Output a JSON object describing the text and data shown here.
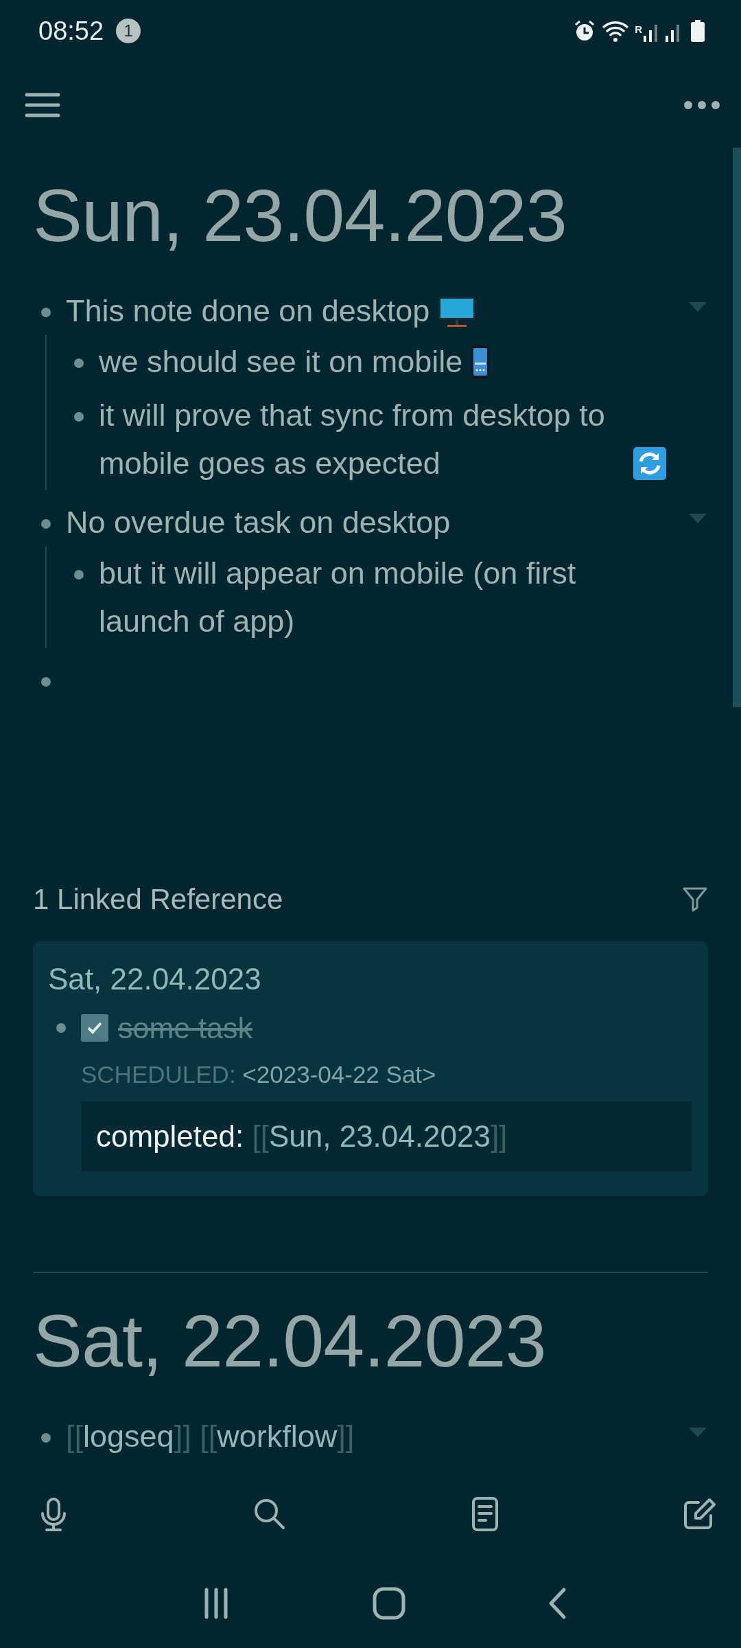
{
  "status_bar": {
    "time": "08:52",
    "notification_count": "1",
    "roaming_indicator": "R"
  },
  "journals": [
    {
      "title": "Sun, 23.04.2023",
      "blocks": [
        {
          "kind": "text",
          "text": "This note done on desktop",
          "trailing": {
            "kind": "monitor"
          },
          "expanded": true,
          "children": [
            {
              "kind": "text",
              "text": "we should see it on mobile",
              "trailing": {
                "kind": "phone"
              }
            },
            {
              "kind": "text",
              "text": "it will prove that sync from desktop to mobile goes as expected",
              "trailing": {
                "kind": "sync"
              }
            }
          ]
        },
        {
          "kind": "text",
          "text": "No overdue task on desktop",
          "expanded": true,
          "children": [
            {
              "kind": "text",
              "text": "but it will appear on mobile (on first launch of app)"
            }
          ]
        },
        {
          "kind": "empty"
        }
      ],
      "linked_references": {
        "heading": "1 Linked Reference",
        "groups": [
          {
            "page": "Sat, 22.04.2023",
            "blocks": [
              {
                "kind": "task",
                "checked": true,
                "text": "some task",
                "scheduled_label": "SCHEDULED:",
                "scheduled_value": "<2023-04-22 Sat>",
                "property": {
                  "key": "completed:",
                  "open": "[[",
                  "value": "Sun, 23.04.2023",
                  "close": "]]"
                }
              }
            ]
          }
        ]
      }
    },
    {
      "title": "Sat, 22.04.2023",
      "blocks": [
        {
          "kind": "links",
          "expanded": true,
          "links": [
            {
              "open": "[[",
              "text": "logseq",
              "close": "]]"
            },
            {
              "open": "[[",
              "text": "workflow",
              "close": "]]"
            }
          ]
        }
      ]
    }
  ]
}
